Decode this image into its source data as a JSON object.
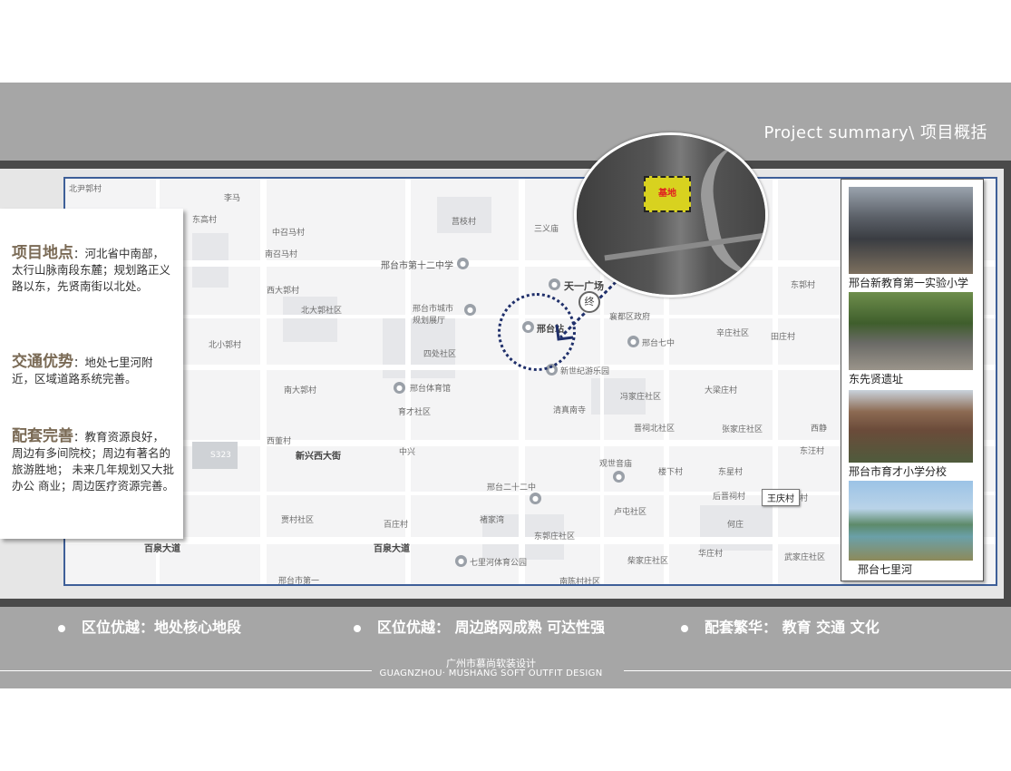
{
  "header": {
    "title": "Project summary\\  项目概括"
  },
  "info": {
    "location_head": "项目地点",
    "location_text": "：河北省中南部，太行山脉南段东麓；规划路正义路以东，先贤南街以北处。",
    "traffic_head": "交通优势",
    "traffic_text": "：地处七里河附近，区域道路系统完善。",
    "facility_head": "配套完善",
    "facility_text": "：教育资源良好，周边有多间院校；周边有著名的旅游胜地；  未来几年规划又大批办公 商业；周边医疗资源完善。"
  },
  "map": {
    "site_label": "基地",
    "terminal_label": "终",
    "wang_label": "王庆村",
    "labels": [
      "北尹郭村",
      "李马",
      "东高村",
      "中召马村",
      "莒枝村",
      "三义庙",
      "南召马村",
      "邢台市第十二中学",
      "天一广场",
      "东郭村",
      "西大郭村",
      "北大郭社区",
      "邢台市城市",
      "规划展厅",
      "邢台站",
      "襄都区政府",
      "辛庄社区",
      "田庄村",
      "北小郭村",
      "四处社区",
      "邢台七中",
      "新世纪游乐园",
      "南大郭村",
      "邢台体育馆",
      "冯家庄社区",
      "大梁庄村",
      "育才社区",
      "清真南寺",
      "晋祠北社区",
      "张家庄社区",
      "西静",
      "西董村",
      "新兴西大街",
      "中兴",
      "东汪村",
      "观世音庙",
      "楼下村",
      "东星村",
      "S323",
      "邢台二十二中",
      "后晋祠村",
      "胡家营村",
      "贾村社区",
      "褚家湾",
      "百庄村",
      "东郭庄社区",
      "卢屯社区",
      "何庄",
      "百泉大道",
      "七里河体育公园",
      "柴家庄社区",
      "华庄村",
      "武家庄社区",
      "邢台市第一",
      "南陈村社区",
      "东郭村"
    ]
  },
  "photos": [
    {
      "caption": "邢台新教育第一实验小学"
    },
    {
      "caption": "东先贤遗址"
    },
    {
      "caption": "邢台市育才小学分校"
    },
    {
      "caption": "邢台七里河"
    }
  ],
  "bullets": [
    "区位优越：地处核心地段",
    "区位优越： 周边路网成熟 可达性强",
    "配套繁华： 教育  交通   文化"
  ],
  "footer": {
    "cn": "广州市慕尚软装设计",
    "en": "GUAGNZHOU· MUSHANG SOFT OUTFIT DESIGN"
  },
  "colors": {
    "band": "#a6a6a6",
    "dark": "#4a4a4a",
    "map_border": "#3e5f98",
    "heading": "#7a6a55",
    "ring": "#1f2f6a",
    "site": "#d8d21f"
  }
}
